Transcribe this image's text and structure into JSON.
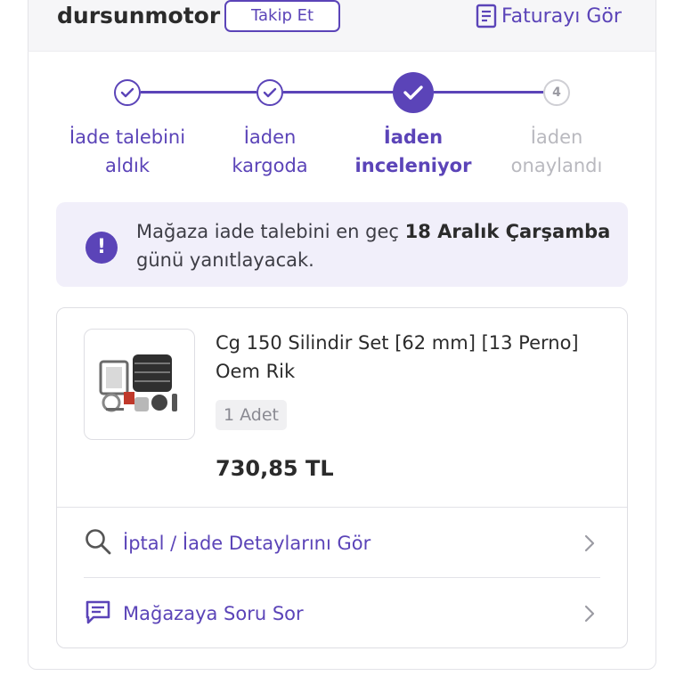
{
  "header": {
    "store_name": "dursunmotor",
    "follow_label": "Takip Et",
    "invoice_label": "Faturayı Gör"
  },
  "steps": [
    {
      "line1": "İade talebini",
      "line2": "aldık",
      "state": "done"
    },
    {
      "line1": "İaden",
      "line2": "kargoda",
      "state": "done"
    },
    {
      "line1": "İaden",
      "line2": "inceleniyor",
      "state": "active"
    },
    {
      "line1": "İaden",
      "line2": "onaylandı",
      "state": "todo",
      "number": "4"
    }
  ],
  "notice": {
    "text_before": "Mağaza iade talebini en geç ",
    "date": "18 Aralık Çarşamba",
    "text_after": " günü yanıtlayacak."
  },
  "product": {
    "title": "Cg 150 Silindir Set [62 mm] [13 Perno] Oem Rik",
    "quantity": "1 Adet",
    "price": "730,85 TL"
  },
  "actions": {
    "details_label": "İptal / İade Detaylarını Gör",
    "ask_label": "Mağazaya Soru Sor"
  },
  "colors": {
    "accent": "#5b44b8",
    "notice_bg": "#f1effa",
    "pending": "#b9b9bf"
  }
}
